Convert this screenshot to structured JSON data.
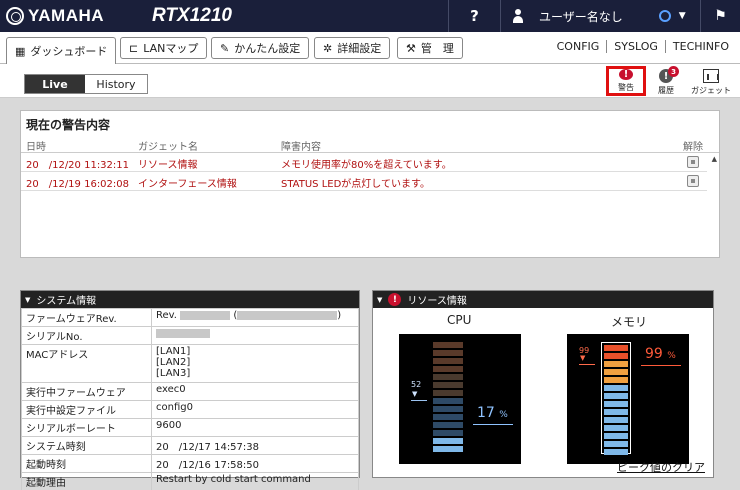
{
  "header": {
    "brand": "YAMAHA",
    "model": "RTX1210",
    "help": "?",
    "user": "ユーザー名なし",
    "bell": "🔔"
  },
  "tabs": [
    {
      "label": "ダッシュボード",
      "icon": "dashboard-icon",
      "glyph": "▦"
    },
    {
      "label": "LANマップ",
      "icon": "lan-map-icon",
      "glyph": "⊏"
    },
    {
      "label": "かんたん設定",
      "icon": "wand-icon",
      "glyph": "✎"
    },
    {
      "label": "詳細設定",
      "icon": "gear-icon",
      "glyph": "✲"
    },
    {
      "label": "管　理",
      "icon": "wrench-icon",
      "glyph": "⚒"
    }
  ],
  "links": [
    "CONFIG",
    "SYSLOG",
    "TECHINFO"
  ],
  "view": {
    "live": "Live",
    "history": "History"
  },
  "gadget_buttons": {
    "alert": "警告",
    "history": "履歴",
    "history_count": "3",
    "gadget": "ガジェット"
  },
  "alert_panel": {
    "title": "現在の警告内容",
    "columns": [
      "日時",
      "ガジェット名",
      "障害内容",
      "解除"
    ],
    "rows": [
      {
        "date": "20　/12/20 11:32:11",
        "gadget": "リソース情報",
        "detail": "メモリ使用率が80%を超えています。"
      },
      {
        "date": "20　/12/19 16:02:08",
        "gadget": "インターフェース情報",
        "detail": "STATUS LEDが点灯しています。"
      }
    ]
  },
  "system_panel": {
    "title": "システム情報",
    "rows": [
      {
        "key": "ファームウェアRev.",
        "value": "Rev."
      },
      {
        "key": "シリアルNo.",
        "value": ""
      },
      {
        "key": "MACアドレス",
        "value": "[LAN1]\n[LAN2]\n[LAN3]"
      },
      {
        "key": "実行中ファームウェア",
        "value": "exec0"
      },
      {
        "key": "実行中設定ファイル",
        "value": "config0"
      },
      {
        "key": "シリアルボーレート",
        "value": "9600"
      },
      {
        "key": "システム時刻",
        "value": "20　/12/17 14:57:38"
      },
      {
        "key": "起動時刻",
        "value": "20　/12/16 17:58:50"
      },
      {
        "key": "起動理由",
        "value": "Restart by cold start command"
      }
    ]
  },
  "resource_panel": {
    "title": "リソース情報",
    "cpu": {
      "label": "CPU",
      "percent": "17",
      "unit": "%",
      "peak": "52",
      "usage": 0.17
    },
    "memory": {
      "label": "メモリ",
      "percent": "99",
      "unit": "%",
      "peak": "99",
      "usage": 0.99
    },
    "clear_peak": "ピーク値のクリア"
  },
  "colors": {
    "header_bg": "#1a1f3a",
    "alert_red": "#c8102e",
    "cpu_bar": "#7fb8e8",
    "mem_bar_warn": "#e8502a"
  }
}
